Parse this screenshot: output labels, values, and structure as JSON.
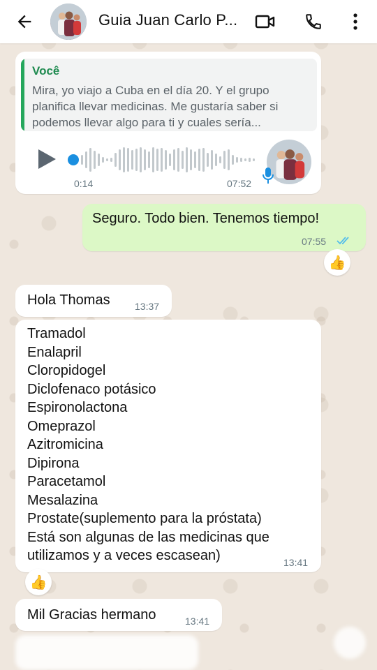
{
  "header": {
    "contact_name": "Guia Juan Carlo P..."
  },
  "messages": {
    "voice_reply": {
      "quote_author": "Você",
      "quote_text": "Mira, yo viajo a Cuba en el día 20. Y el grupo planifica llevar medicinas. Me gustaría saber si podemos llevar algo para ti y cuales sería...",
      "elapsed": "0:14",
      "time": "07:52"
    },
    "outgoing_1": {
      "text": "Seguro. Todo bien. Tenemos tiempo!",
      "time": "07:55",
      "status": "read"
    },
    "reaction_1": "👍",
    "incoming_1": {
      "text": "Hola Thomas",
      "time": "13:37"
    },
    "incoming_2": {
      "lines": [
        "Tramadol",
        "Enalapril",
        "Cloropidogel",
        "Diclofenaco potásico",
        "Espironolactona",
        "Omeprazol",
        "Azitromicina",
        "Dipirona",
        "Paracetamol",
        "Mesalazina",
        "Prostate(suplemento para la próstata)",
        "Está son algunas de las medicinas que",
        "utilizamos y a veces escasean)"
      ],
      "time": "13:41"
    },
    "reaction_2": "👍",
    "incoming_3": {
      "text": "Mil Gracias hermano",
      "time": "13:41"
    }
  },
  "colors": {
    "header_bg": "#ffffff",
    "wallpaper": "#efe7de",
    "outgoing_bubble": "#dcf8c6",
    "incoming_bubble": "#ffffff",
    "quote_accent": "#25a75c",
    "voice_dot": "#1a8fe0",
    "read_ticks": "#53bdeb"
  },
  "icons": {
    "back": "arrow-left-icon",
    "video": "video-camera-icon",
    "call": "phone-icon",
    "menu": "more-vertical-icon",
    "play": "play-icon",
    "mic": "microphone-icon",
    "ticks": "double-check-icon"
  }
}
